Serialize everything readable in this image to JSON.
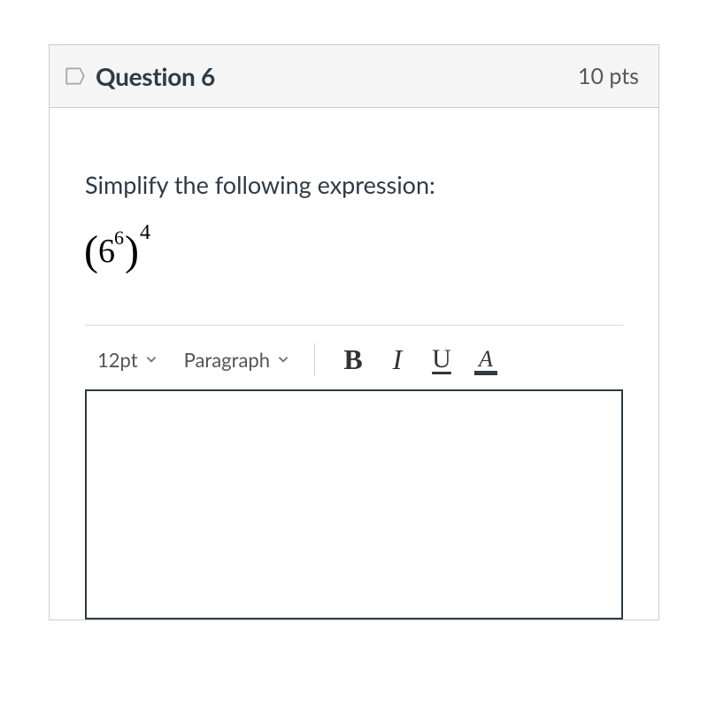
{
  "header": {
    "title": "Question 6",
    "points": "10 pts"
  },
  "body": {
    "prompt": "Simplify the following expression:",
    "expression": {
      "lparen": "(",
      "base": "6",
      "inner_exponent": "6",
      "rparen": ")",
      "outer_exponent": "4"
    }
  },
  "toolbar": {
    "font_size": "12pt",
    "block_format": "Paragraph",
    "bold": "B",
    "italic": "I",
    "underline": "U",
    "text_color": "A"
  }
}
